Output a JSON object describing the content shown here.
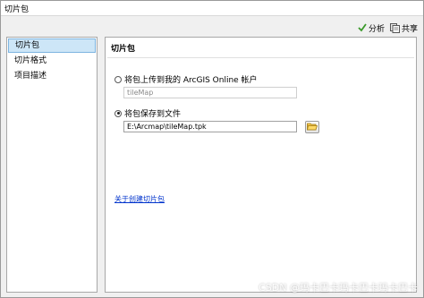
{
  "window": {
    "title": "切片包"
  },
  "toolbar": {
    "analyze_label": "分析",
    "share_label": "共享"
  },
  "nav": {
    "items": [
      {
        "label": "切片包",
        "selected": true
      },
      {
        "label": "切片格式",
        "selected": false
      },
      {
        "label": "项目描述",
        "selected": false
      }
    ]
  },
  "panel": {
    "title": "切片包",
    "option_upload_label": "将包上传到我的 ArcGIS Online 帐户",
    "upload_name_value": "tileMap",
    "option_save_label": "将包保存到文件",
    "save_path_value": "E:\\Arcmap\\tileMap.tpk",
    "link_label": "关于创建切片包"
  },
  "watermark": {
    "text": "CSDN @玛卡巴卡玛卡巴卡玛卡巴卡"
  },
  "colors": {
    "selected_bg": "#cde6f7",
    "link": "#0033cc",
    "check_green": "#3a9a2a"
  }
}
